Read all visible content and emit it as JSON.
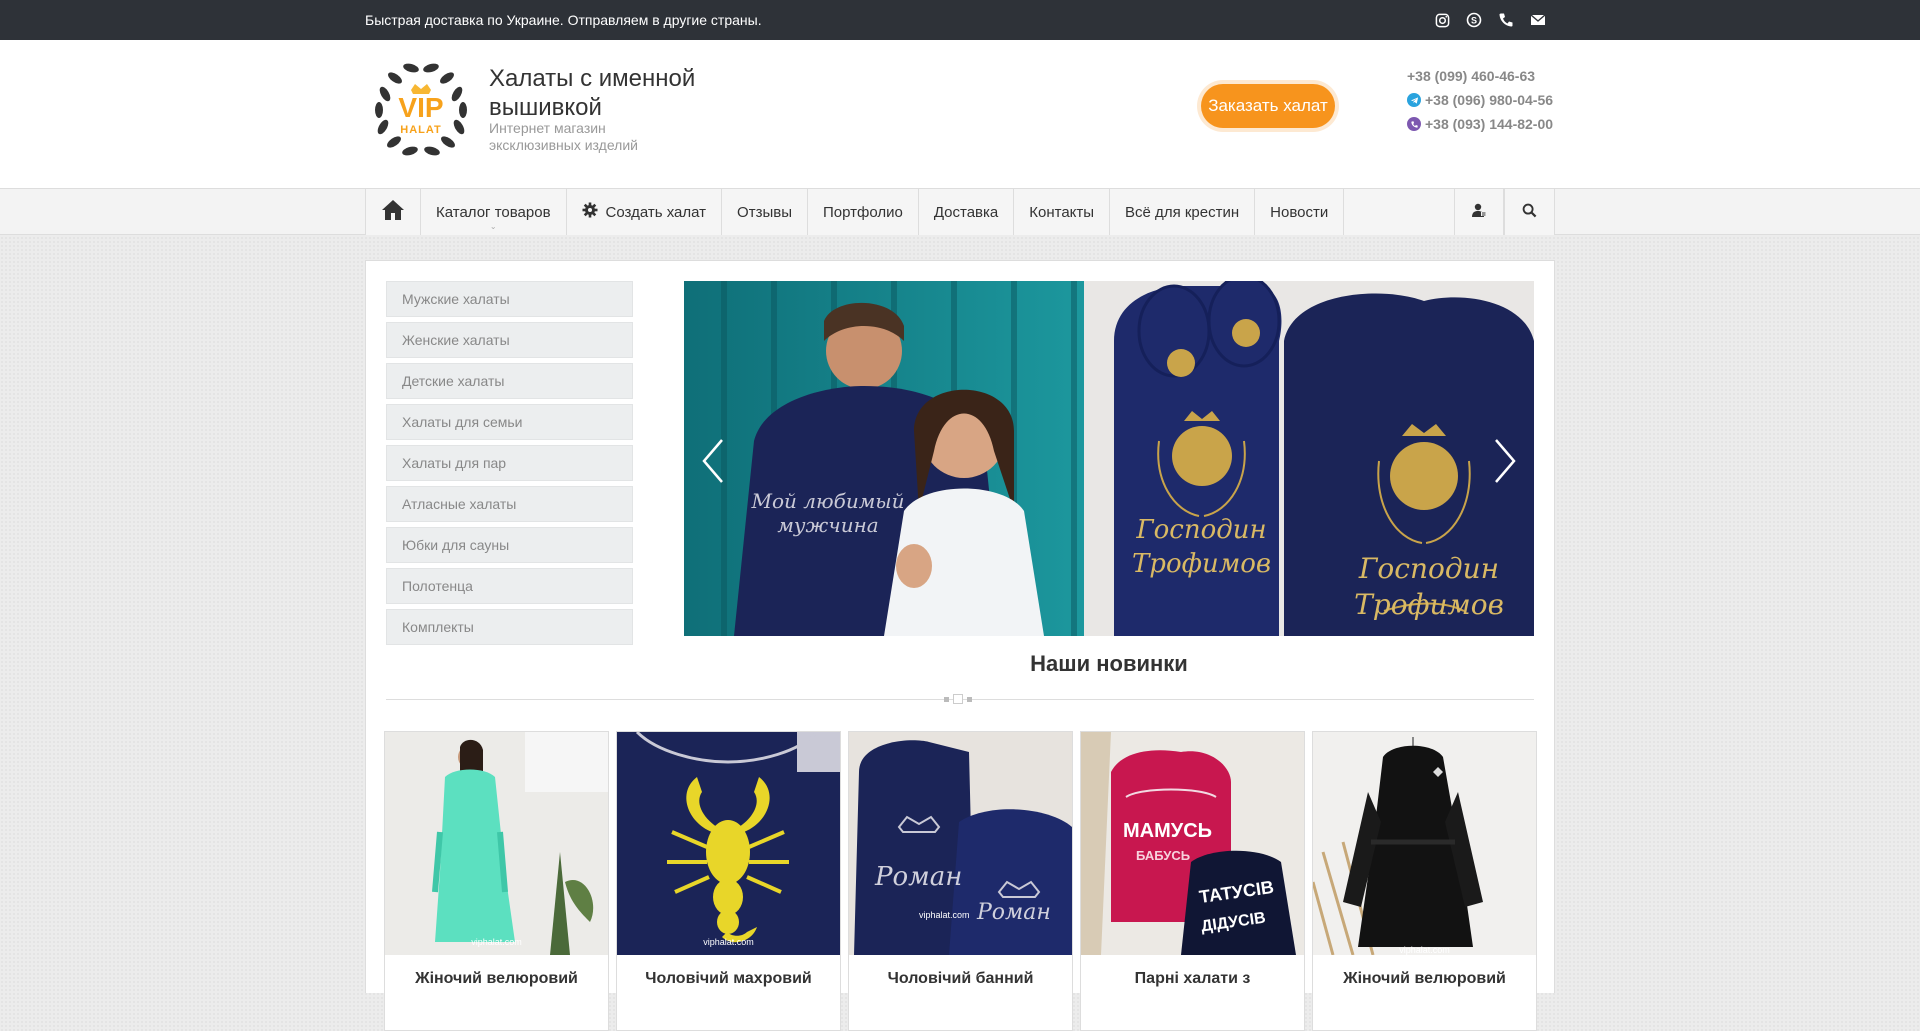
{
  "topbar": {
    "message": "Быстрая доставка по Украине. Отправляем в другие страны.",
    "icons": [
      "instagram-icon",
      "skype-icon",
      "phone-icon",
      "mail-icon"
    ]
  },
  "header": {
    "logo_text_top": "VIP",
    "logo_text_bottom": "HALAT",
    "title": "Халаты с именной вышивкой",
    "subtitle": "Интернет магазин эксклюзивных изделий",
    "order_button": "Заказать халат",
    "phones": [
      {
        "number": "+38 (099) 460-46-63",
        "icon": ""
      },
      {
        "number": "+38 (096) 980-04-56",
        "icon": "telegram-icon"
      },
      {
        "number": "+38 (093) 144-82-00",
        "icon": "viber-icon"
      }
    ]
  },
  "nav": {
    "items": [
      "Каталог товаров",
      "Создать халат",
      "Отзывы",
      "Портфолио",
      "Доставка",
      "Контакты",
      "Всё для крестин",
      "Новости"
    ]
  },
  "categories": [
    "Мужские халаты",
    "Женские халаты",
    "Детские халаты",
    "Халаты для семьи",
    "Халаты для пар",
    "Атласные халаты",
    "Юбки для сауны",
    "Полотенца",
    "Комплекты"
  ],
  "slider": {
    "text_left_1": "Мой любимый",
    "text_left_2": "мужчина",
    "text_right_1": "Господин",
    "text_right_2": "Трофимов"
  },
  "new_section": {
    "title": "Наши новинки"
  },
  "products": [
    {
      "name": "Жіночий велюровий"
    },
    {
      "name": "Чоловічий махровий"
    },
    {
      "name": "Чоловічий банний"
    },
    {
      "name": "Парні халати з"
    },
    {
      "name": "Жіночий велюровий"
    }
  ],
  "product_images": {
    "watermark": "viphalat.com",
    "embroidery_1": "Роман",
    "embroidery_2": "МАМУСЬ",
    "embroidery_3": "БАБУСЬ",
    "embroidery_4": "ТАТУСІВ",
    "embroidery_5": "ДІДУСІВ"
  },
  "colors": {
    "accent": "#f7941d",
    "topbar": "#2e3238",
    "navy": "#1b2457"
  }
}
